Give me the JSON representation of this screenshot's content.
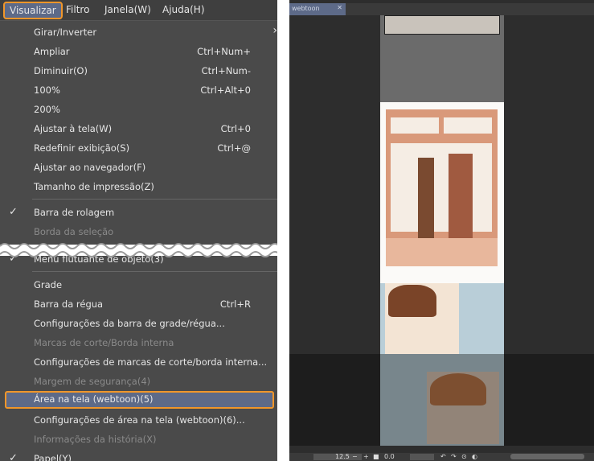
{
  "menubar": {
    "items": [
      "Visualizar",
      "Filtro",
      "Janela(W)",
      "Ajuda(H)"
    ]
  },
  "menu": {
    "items": [
      {
        "label": "Girar/Inverter",
        "shortcut": "",
        "submenu": true
      },
      {
        "label": "Ampliar",
        "shortcut": "Ctrl+Num+"
      },
      {
        "label": "Diminuir(O)",
        "shortcut": "Ctrl+Num-"
      },
      {
        "label": "100%",
        "shortcut": "Ctrl+Alt+0"
      },
      {
        "label": "200%",
        "shortcut": ""
      },
      {
        "label": "Ajustar à tela(W)",
        "shortcut": "Ctrl+0"
      },
      {
        "label": "Redefinir exibição(S)",
        "shortcut": "Ctrl+@"
      },
      {
        "label": "Ajustar ao navegador(F)",
        "shortcut": ""
      },
      {
        "label": "Tamanho de impressão(Z)",
        "shortcut": ""
      },
      {
        "label": "Barra de rolagem",
        "shortcut": "",
        "checked": true
      },
      {
        "label": "Borda da seleção",
        "shortcut": "",
        "disabled": true
      },
      {
        "label": "Menu flutuante de objeto(3)",
        "shortcut": "",
        "checked": true
      },
      {
        "label": "Grade",
        "shortcut": ""
      },
      {
        "label": "Barra da régua",
        "shortcut": "Ctrl+R"
      },
      {
        "label": "Configurações da barra de grade/régua...",
        "shortcut": ""
      },
      {
        "label": "Marcas de corte/Borda interna",
        "shortcut": "",
        "disabled": true
      },
      {
        "label": "Configurações de marcas de corte/borda interna...",
        "shortcut": ""
      },
      {
        "label": "Margem de segurança(4)",
        "shortcut": "",
        "disabled": true
      },
      {
        "label": "Área na tela (webtoon)(5)",
        "shortcut": "",
        "highlighted": true
      },
      {
        "label": "Configurações de área na tela (webtoon)(6)...",
        "shortcut": ""
      },
      {
        "label": "Informações da história(X)",
        "shortcut": "",
        "disabled": true
      },
      {
        "label": "Papel(Y)",
        "shortcut": "",
        "checked": true
      }
    ]
  },
  "canvas": {
    "tab": "webtoon",
    "zoom": "12.5",
    "rotation": "0.0"
  },
  "colors": {
    "highlight": "#5d6a88",
    "accent_border": "#f0962a"
  }
}
